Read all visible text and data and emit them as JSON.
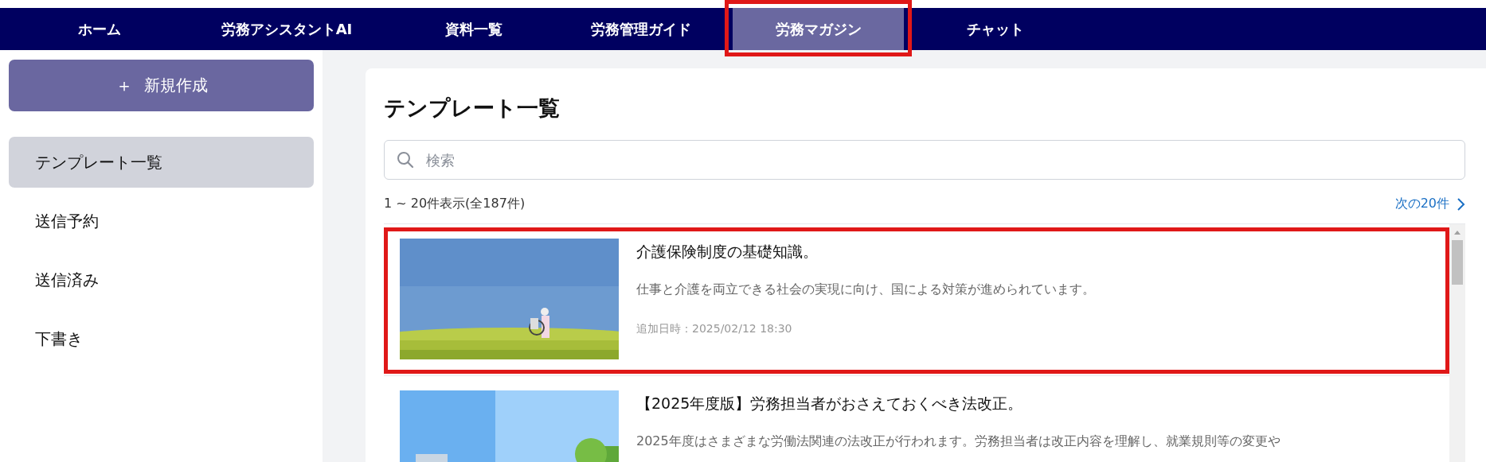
{
  "nav": [
    {
      "label": "ホーム",
      "selected": false,
      "highlighted": false
    },
    {
      "label": "労務アシスタントAI",
      "selected": false,
      "highlighted": false
    },
    {
      "label": "資料一覧",
      "selected": false,
      "highlighted": false
    },
    {
      "label": "労務管理ガイド",
      "selected": false,
      "highlighted": false
    },
    {
      "label": "労務マガジン",
      "selected": true,
      "highlighted": true
    },
    {
      "label": "チャット",
      "selected": false,
      "highlighted": false
    }
  ],
  "sidebar": {
    "new_button": {
      "icon": "＋",
      "label": "新規作成"
    },
    "items": [
      {
        "label": "テンプレート一覧",
        "selected": true
      },
      {
        "label": "送信予約",
        "selected": false
      },
      {
        "label": "送信済み",
        "selected": false
      },
      {
        "label": "下書き",
        "selected": false
      }
    ]
  },
  "main": {
    "title": "テンプレート一覧",
    "search": {
      "placeholder": "検索"
    },
    "count": "1 ~ 20件表示(全187件)",
    "next_link": "次の20件",
    "articles": [
      {
        "kind": "picture",
        "title": "介護保険制度の基礎知識。",
        "description": "仕事と介護を両立できる社会の実現に向け、国による対策が進められています。",
        "date": "追加日時：2025/02/12 18:30",
        "highlighted": true
      },
      {
        "kind": "picture",
        "title": "【2025年度版】労務担当者がおさえておくべき法改正。",
        "description": "2025年度はさまざまな労働法関連の法改正が行われます。労務担当者は改正内容を理解し、就業規則等の変更や",
        "highlighted": false
      }
    ]
  }
}
